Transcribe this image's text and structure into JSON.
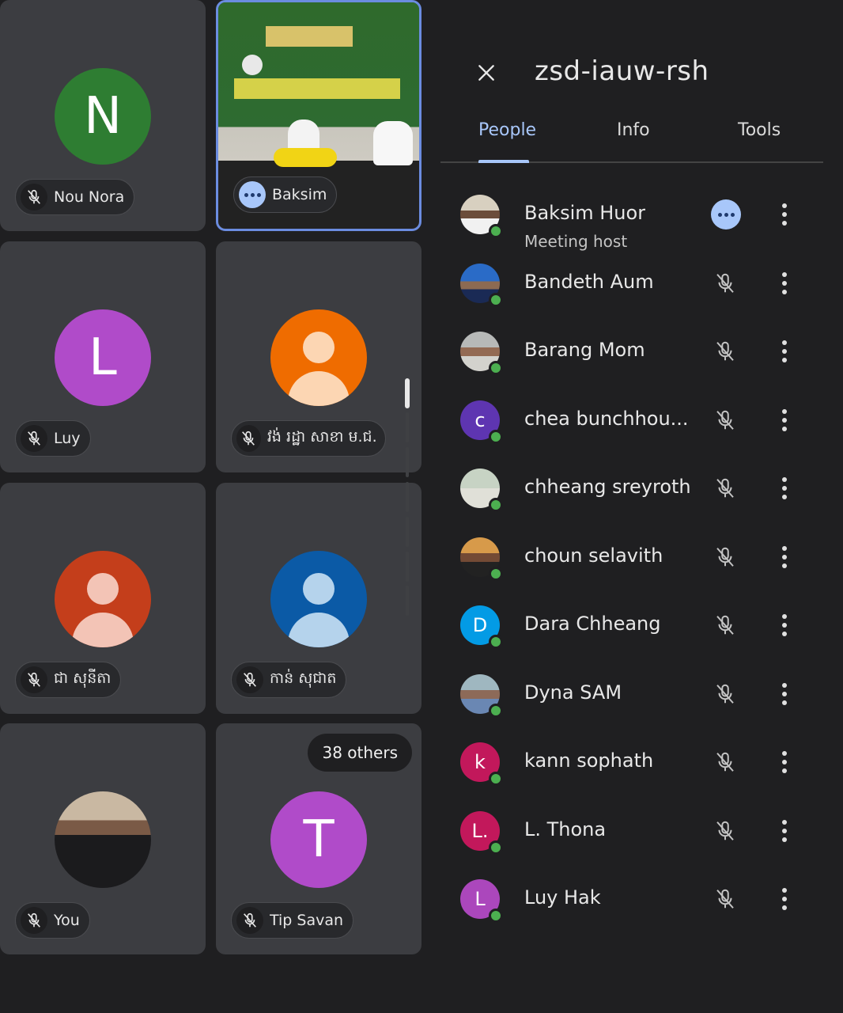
{
  "grid": {
    "tiles": [
      {
        "initial": "N",
        "name": "Nou Nora",
        "color": "#2e7d32"
      },
      {
        "name": "Baksim",
        "speaking": true
      },
      {
        "initial": "L",
        "name": "Luy",
        "color": "#b04bc9"
      },
      {
        "name": "វង់ រដ្ឋា សាខា ម.ជ.ជ",
        "color": "#ef6c00",
        "head_color": "#fcd6b3"
      },
      {
        "name": "ជា សុនីតា",
        "color": "#c43e1b",
        "head_color": "#f3c4b6"
      },
      {
        "name": "កាន់ សុជាត",
        "color": "#0b5aa6",
        "head_color": "#b5d3ec"
      },
      {
        "name": "You"
      },
      {
        "initial": "T",
        "name": "Tip Savan",
        "color": "#b04bc9",
        "others": "38 others"
      }
    ]
  },
  "panel": {
    "meeting_code": "zsd-iauw-rsh",
    "tabs": [
      "People",
      "Info",
      "Tools"
    ],
    "participants": [
      {
        "name": "Baksim Huor",
        "subtitle": "Meeting host",
        "speaking": true
      },
      {
        "name": "Bandeth Aum"
      },
      {
        "name": "Barang Mom"
      },
      {
        "name": "chea bunchhou...",
        "initial": "c",
        "color": "#5e35b1"
      },
      {
        "name": "chheang sreyroth"
      },
      {
        "name": "choun selavith"
      },
      {
        "name": "Dara Chheang",
        "initial": "D",
        "color": "#039be5"
      },
      {
        "name": "Dyna SAM"
      },
      {
        "name": "kann sophath",
        "initial": "k",
        "color": "#c2185b"
      },
      {
        "name": "L. Thona",
        "initial": "L.",
        "color": "#c2185b"
      },
      {
        "name": "Luy Hak",
        "initial": "L",
        "color": "#ab47bc"
      }
    ]
  }
}
